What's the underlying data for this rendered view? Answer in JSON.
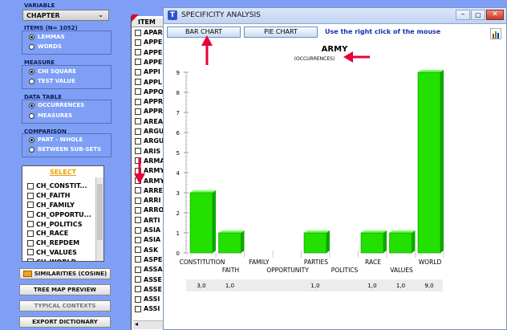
{
  "left_panel": {
    "variable_title": "VARIABLE",
    "variable_value": "CHAPTER",
    "items_title": "ITEMS (N= 1052)",
    "items_options": [
      "LEMMAS",
      "WORDS"
    ],
    "measure_title": "MEASURE",
    "measure_options": [
      "CHI SQUARE",
      "TEST VALUE"
    ],
    "data_table_title": "DATA TABLE",
    "data_table_options": [
      "OCCURRENCES",
      "MEASURES"
    ],
    "comparison_title": "COMPARISON",
    "comparison_options": [
      "PART - WHOLE",
      "BETWEEN SUB-SETS"
    ],
    "select_label": "SELECT",
    "select_items": [
      "CH_CONSTIT...",
      "CH_FAITH",
      "CH_FAMILY",
      "CH_OPPORTU...",
      "CH_POLITICS",
      "CH_RACE",
      "CH_REPDEM",
      "CH_VALUES",
      "CH_WORLD"
    ],
    "buttons": [
      "SIMILARITIES (COSINE)",
      "TREE MAP PREVIEW",
      "TYPICAL CONTEXTS",
      "EXPORT DICTIONARY"
    ]
  },
  "item_list": {
    "header": "ITEM",
    "items": [
      "APAR",
      "APPE",
      "APPE",
      "APPE",
      "APPI",
      "APPL",
      "APPO",
      "APPR",
      "APPR",
      "AREA",
      "ARGU",
      "ARGU",
      "ARIS",
      "ARMA",
      "ARMY",
      "ARMY",
      "ARRE",
      "ARRI",
      "ARRO",
      "ARTI",
      "ASIA",
      "ASIA",
      "ASK",
      "ASPE",
      "ASSA",
      "ASSE",
      "ASSE",
      "ASSI",
      "ASSI"
    ]
  },
  "window": {
    "title": "SPECIFICITY ANALYSIS",
    "bar_chart_button": "BAR CHART",
    "pie_chart_button": "PIE CHART",
    "hint": "Use the right click of the mouse"
  },
  "chart_data": {
    "type": "bar",
    "title": "ARMY",
    "subtitle": "(OCCURRENCES)",
    "categories": [
      "CONSTITUTION",
      "FAITH",
      "FAMILY",
      "OPPORTUNITY",
      "PARTIES",
      "POLITICS",
      "RACE",
      "VALUES",
      "WORLD"
    ],
    "values": [
      3,
      1,
      0,
      0,
      1,
      0,
      1,
      1,
      9
    ],
    "value_labels": [
      "3,0",
      "1,0",
      "",
      "",
      "1,0",
      "",
      "1,0",
      "1,0",
      "9,0"
    ],
    "y_ticks": [
      "0",
      "1",
      "2",
      "3",
      "4",
      "5",
      "6",
      "7",
      "8",
      "9"
    ],
    "ylim": [
      0,
      9
    ],
    "bar_color": "#22e000"
  }
}
